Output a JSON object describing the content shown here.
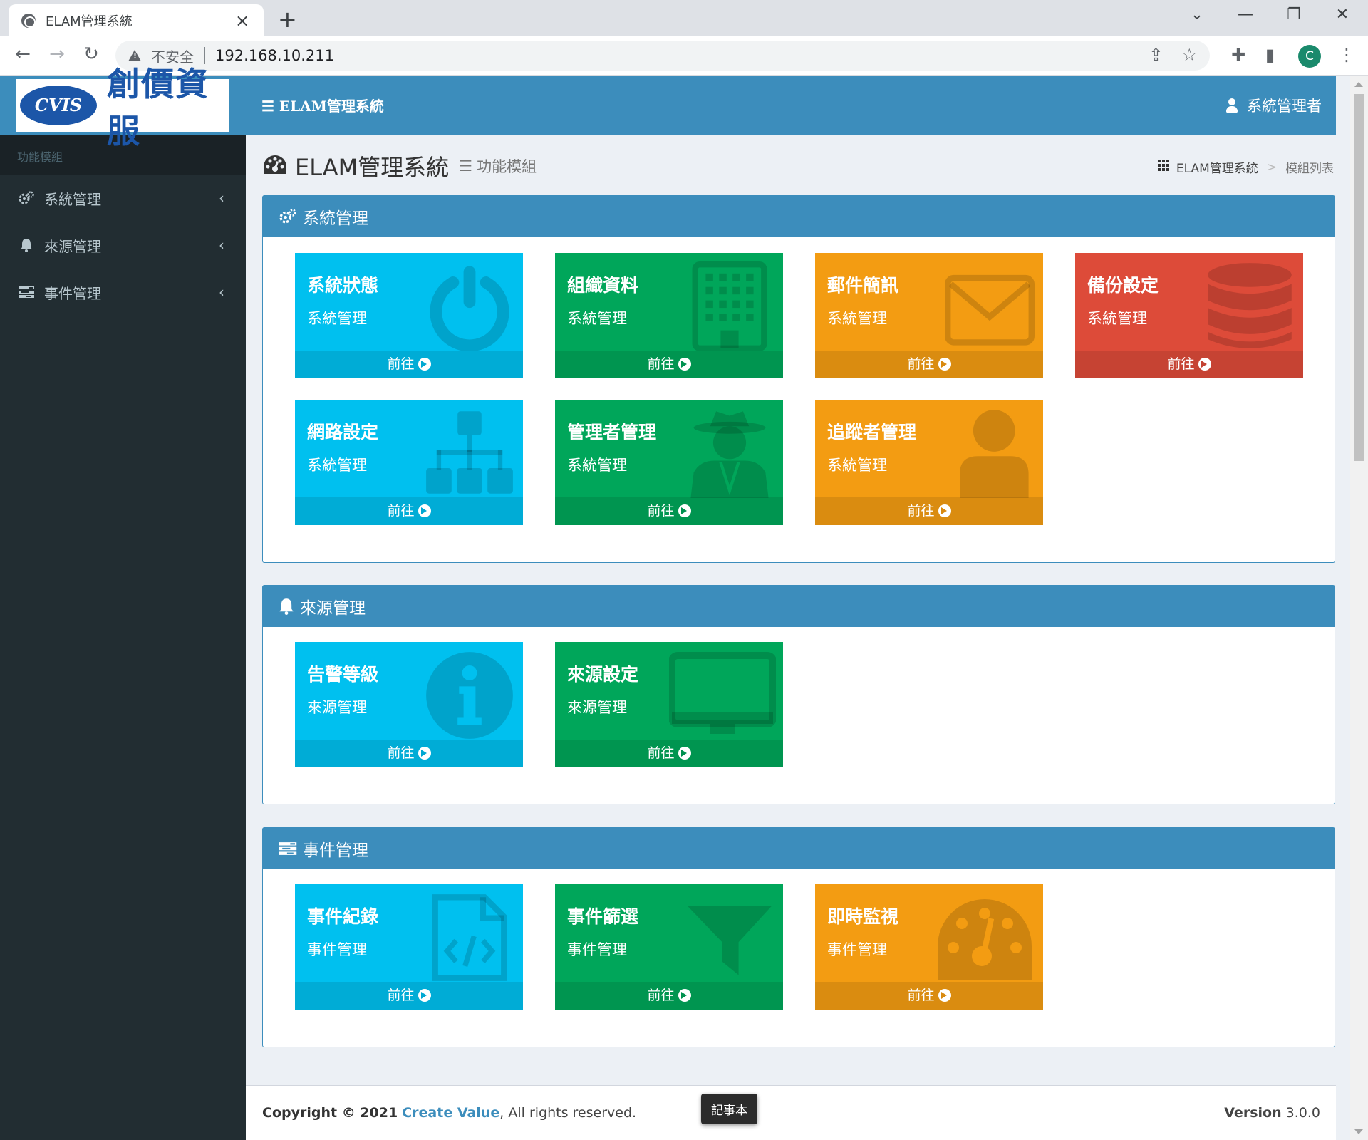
{
  "browser": {
    "tab_title": "ELAM管理系統",
    "insecure_label": "不安全",
    "url": "192.168.10.211",
    "profile_initial": "C"
  },
  "sidebar": {
    "logo_badge": "CVIS",
    "logo_text": "創價資服",
    "header": "功能模組",
    "items": [
      {
        "label": "系統管理",
        "icon": "cogs-icon"
      },
      {
        "label": "來源管理",
        "icon": "bell-icon"
      },
      {
        "label": "事件管理",
        "icon": "tasks-icon"
      }
    ]
  },
  "header": {
    "app_title": "ELAM管理系統",
    "user": "系統管理者"
  },
  "content": {
    "title": "ELAM管理系統",
    "subtitle": "功能模組",
    "breadcrumb": [
      "ELAM管理系統",
      "模組列表"
    ]
  },
  "go_label": "前往",
  "panels": [
    {
      "title": "系統管理",
      "tiles": [
        {
          "title": "系統狀態",
          "sub": "系統管理",
          "color": "#00c0ef",
          "icon": "power-icon"
        },
        {
          "title": "組織資料",
          "sub": "系統管理",
          "color": "#00a65a",
          "icon": "building-icon"
        },
        {
          "title": "郵件簡訊",
          "sub": "系統管理",
          "color": "#f39c12",
          "icon": "envelope-icon"
        },
        {
          "title": "備份設定",
          "sub": "系統管理",
          "color": "#dd4b39",
          "icon": "database-icon"
        },
        {
          "title": "網路設定",
          "sub": "系統管理",
          "color": "#00c0ef",
          "icon": "sitemap-icon"
        },
        {
          "title": "管理者管理",
          "sub": "系統管理",
          "color": "#00a65a",
          "icon": "user-secret-icon"
        },
        {
          "title": "追蹤者管理",
          "sub": "系統管理",
          "color": "#f39c12",
          "icon": "user-icon"
        }
      ]
    },
    {
      "title": "來源管理",
      "tiles": [
        {
          "title": "告警等級",
          "sub": "來源管理",
          "color": "#00c0ef",
          "icon": "info-circle-icon"
        },
        {
          "title": "來源設定",
          "sub": "來源管理",
          "color": "#00a65a",
          "icon": "desktop-icon"
        }
      ]
    },
    {
      "title": "事件管理",
      "tiles": [
        {
          "title": "事件紀錄",
          "sub": "事件管理",
          "color": "#00c0ef",
          "icon": "file-code-icon"
        },
        {
          "title": "事件篩選",
          "sub": "事件管理",
          "color": "#00a65a",
          "icon": "filter-icon"
        },
        {
          "title": "即時監視",
          "sub": "事件管理",
          "color": "#f39c12",
          "icon": "dashboard-icon"
        }
      ]
    }
  ],
  "footer": {
    "copyright_prefix": "Copyright © 2021",
    "company": "Create Value",
    "rights": ", All rights reserved.",
    "version_label": "Version",
    "version": "3.0.0"
  },
  "tooltip": "記事本"
}
